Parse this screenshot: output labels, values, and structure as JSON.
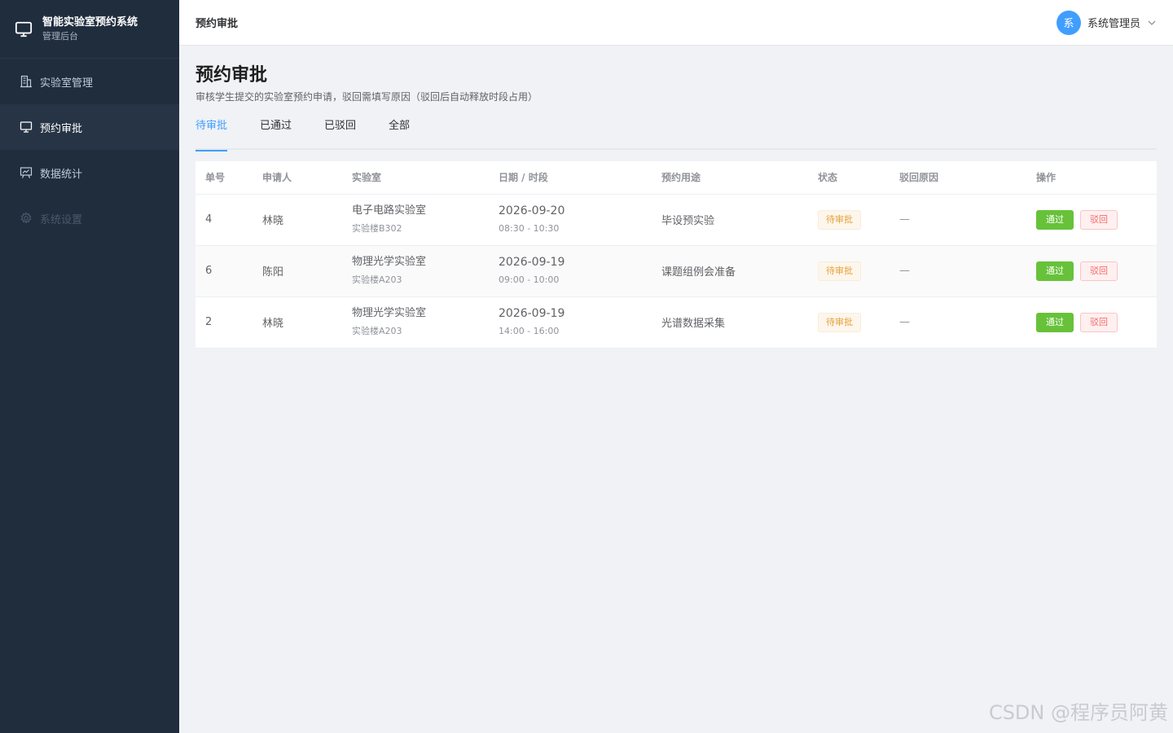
{
  "sidebar": {
    "brand_title": "智能实验室预约系统",
    "brand_subtitle": "管理后台",
    "items": [
      {
        "label": "实验室管理",
        "icon": "building-icon"
      },
      {
        "label": "预约审批",
        "icon": "monitor-icon"
      },
      {
        "label": "数据统计",
        "icon": "chart-board-icon"
      },
      {
        "label": "系统设置",
        "icon": "gear-icon"
      }
    ]
  },
  "header": {
    "title": "预约审批",
    "avatar_text": "系",
    "user_name": "系统管理员"
  },
  "page": {
    "title": "预约审批",
    "description": "审核学生提交的实验室预约申请，驳回需填写原因（驳回后自动释放时段占用）"
  },
  "tabs": [
    {
      "label": "待审批"
    },
    {
      "label": "已通过"
    },
    {
      "label": "已驳回"
    },
    {
      "label": "全部"
    }
  ],
  "table": {
    "columns": [
      "单号",
      "申请人",
      "实验室",
      "日期 / 时段",
      "预约用途",
      "状态",
      "驳回原因",
      "操作"
    ],
    "rows": [
      {
        "id": "4",
        "applicant": "林晓",
        "lab": "电子电路实验室",
        "building": "实验楼B302",
        "date": "2026-09-20",
        "time": "08:30 - 10:30",
        "purpose": "毕设预实验",
        "status": "待审批",
        "reason": "—",
        "pass": "通过",
        "reject": "驳回"
      },
      {
        "id": "6",
        "applicant": "陈阳",
        "lab": "物理光学实验室",
        "building": "实验楼A203",
        "date": "2026-09-19",
        "time": "09:00 - 10:00",
        "purpose": "课题组例会准备",
        "status": "待审批",
        "reason": "—",
        "pass": "通过",
        "reject": "驳回"
      },
      {
        "id": "2",
        "applicant": "林晓",
        "lab": "物理光学实验室",
        "building": "实验楼A203",
        "date": "2026-09-19",
        "time": "14:00 - 16:00",
        "purpose": "光谱数据采集",
        "status": "待审批",
        "reason": "—",
        "pass": "通过",
        "reject": "驳回"
      }
    ]
  },
  "watermark": "CSDN @程序员阿黄"
}
